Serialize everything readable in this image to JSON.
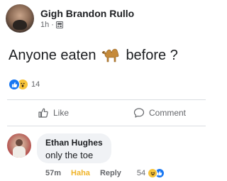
{
  "post": {
    "author": "Gigh Brandon Rullo",
    "time": "1h",
    "separator": "·",
    "privacy_icon": "globe-icon",
    "text_before": "Anyone eaten",
    "text_emoji": "camel-icon",
    "text_after": "before ?",
    "reactions": {
      "icons": [
        "like-icon",
        "wow-icon"
      ],
      "count": "14"
    }
  },
  "actions": {
    "like_label": "Like",
    "comment_label": "Comment"
  },
  "comment": {
    "author": "Ethan Hughes",
    "text": "only the toe",
    "time": "57m",
    "haha_label": "Haha",
    "reply_label": "Reply",
    "reaction_count": "54",
    "reaction_icons": [
      "haha-icon",
      "like-icon"
    ]
  },
  "colors": {
    "link_blue": "#1877f2",
    "haha_yellow": "#f0b429",
    "meta_gray": "#65676b",
    "bubble_bg": "#f0f2f5"
  }
}
